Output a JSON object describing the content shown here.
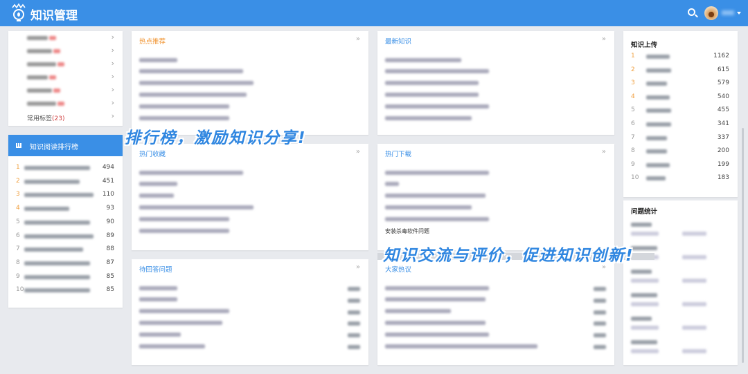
{
  "header": {
    "title": "知识管理"
  },
  "categories": {
    "last_label": "常用标签",
    "last_count": "(23)",
    "rows": 7
  },
  "reading_rank": {
    "title": "知识阅读排行榜",
    "values": [
      "494",
      "451",
      "110",
      "93",
      "90",
      "89",
      "88",
      "87",
      "85",
      "85"
    ]
  },
  "panels": {
    "hot": "热点推荐",
    "latest": "最新知识",
    "fav": "热门收藏",
    "download": "热门下载",
    "download_visible_item": "安装杀毒软件问题",
    "pending": "待回答问题",
    "discuss": "大家热议"
  },
  "upload": {
    "title": "知识上传",
    "values": [
      "1162",
      "615",
      "579",
      "540",
      "455",
      "341",
      "337",
      "200",
      "199",
      "183"
    ]
  },
  "stats": {
    "title": "问题统计"
  },
  "slogans": [
    "排行榜，激励知识分享!",
    "知识交流与评价，促进知识创新!"
  ],
  "colors": {
    "brand": "#3a8fe6",
    "hot": "#f0902a",
    "rank_top": "#f0a040"
  }
}
